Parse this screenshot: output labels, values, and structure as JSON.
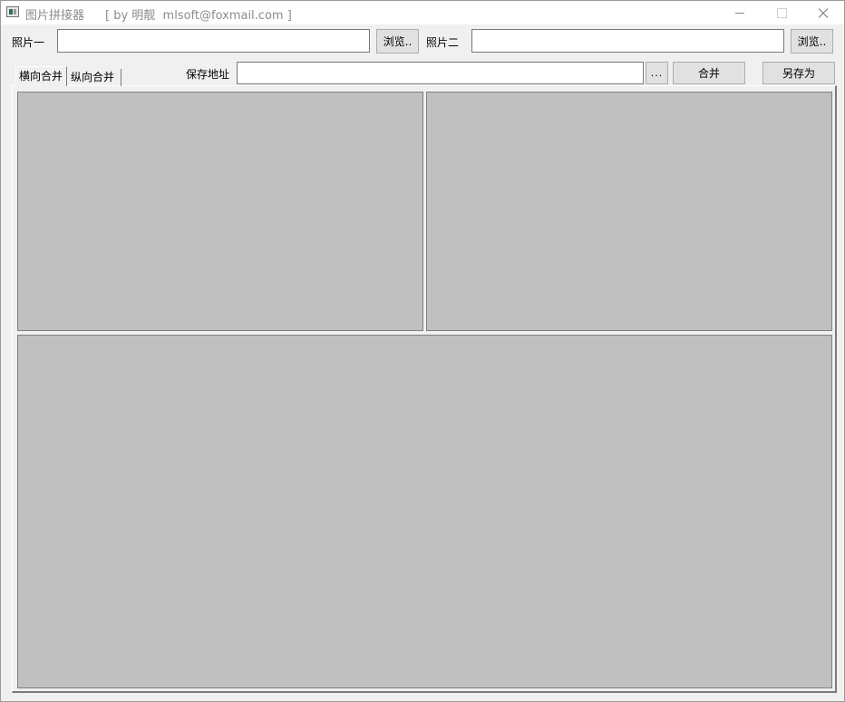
{
  "window": {
    "title": "图片拼接器",
    "subtitle": "[ by 明靓  mlsoft@foxmail.com ]"
  },
  "photo1": {
    "label": "照片一",
    "value": "",
    "browse_label": "浏览.."
  },
  "photo2": {
    "label": "照片二",
    "value": "",
    "browse_label": "浏览.."
  },
  "tabs": [
    {
      "label": "横向合并",
      "active": true
    },
    {
      "label": "纵向合并",
      "active": false
    }
  ],
  "save": {
    "label": "保存地址",
    "value": "",
    "pick_label": "...",
    "merge_label": "合并",
    "save_as_label": "另存为"
  },
  "colors": {
    "window_bg": "#f0f0f0",
    "pane_bg": "#c0c0c0"
  }
}
